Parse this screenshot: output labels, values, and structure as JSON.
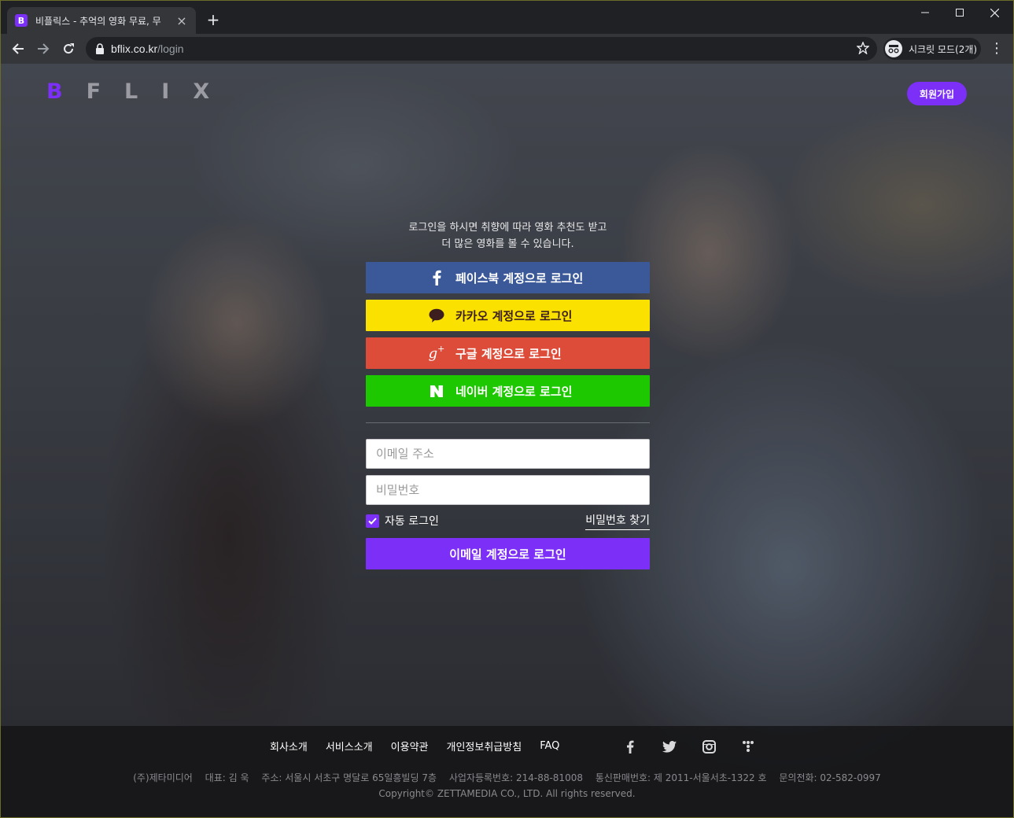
{
  "browser": {
    "tab_title": "비플릭스 - 추억의 영화 무료, 무",
    "tab_favicon_letter": "B",
    "url_host": "bflix.co.kr",
    "url_path": "/login",
    "incognito_label": "시크릿 모드(2개)"
  },
  "header": {
    "logo_letters": [
      "B",
      "F",
      "L",
      "I",
      "X"
    ],
    "signup_label": "회원가입"
  },
  "login": {
    "intro_line1": "로그인을 하시면 취향에 따라 영화 추천도 받고",
    "intro_line2": "더 많은 영화를 볼 수 있습니다.",
    "facebook_label": "페이스북 계정으로 로그인",
    "kakao_label": "카카오 계정으로 로그인",
    "google_label": "구글 계정으로 로그인",
    "naver_label": "네이버 계정으로 로그인",
    "email_placeholder": "이메일 주소",
    "password_placeholder": "비밀번호",
    "email_value": "",
    "password_value": "",
    "auto_login_label": "자동 로그인",
    "auto_login_checked": true,
    "find_password_label": "비밀번호 찾기",
    "email_login_label": "이메일 계정으로 로그인"
  },
  "footer": {
    "links": [
      "회사소개",
      "서비스소개",
      "이용약관",
      "개인정보취급방침",
      "FAQ"
    ],
    "social_icons": [
      "facebook-icon",
      "twitter-icon",
      "instagram-icon",
      "app-icon"
    ],
    "info": [
      "(주)제타미디어",
      "대표: 김 욱",
      "주소: 서울시 서초구 명달로 65일흥빌딩 7층",
      "사업자등록번호: 214-88-81008",
      "통신판매번호: 제 2011-서울서초-1322 호",
      "문의전화: 02-582-0997"
    ],
    "copyright": "Copyright© ZETTAMEDIA CO., LTD. All rights reserved."
  },
  "colors": {
    "brand": "#7b2ff7",
    "facebook": "#3b5998",
    "kakao": "#fae100",
    "google": "#dd4b39",
    "naver": "#1ec800"
  }
}
